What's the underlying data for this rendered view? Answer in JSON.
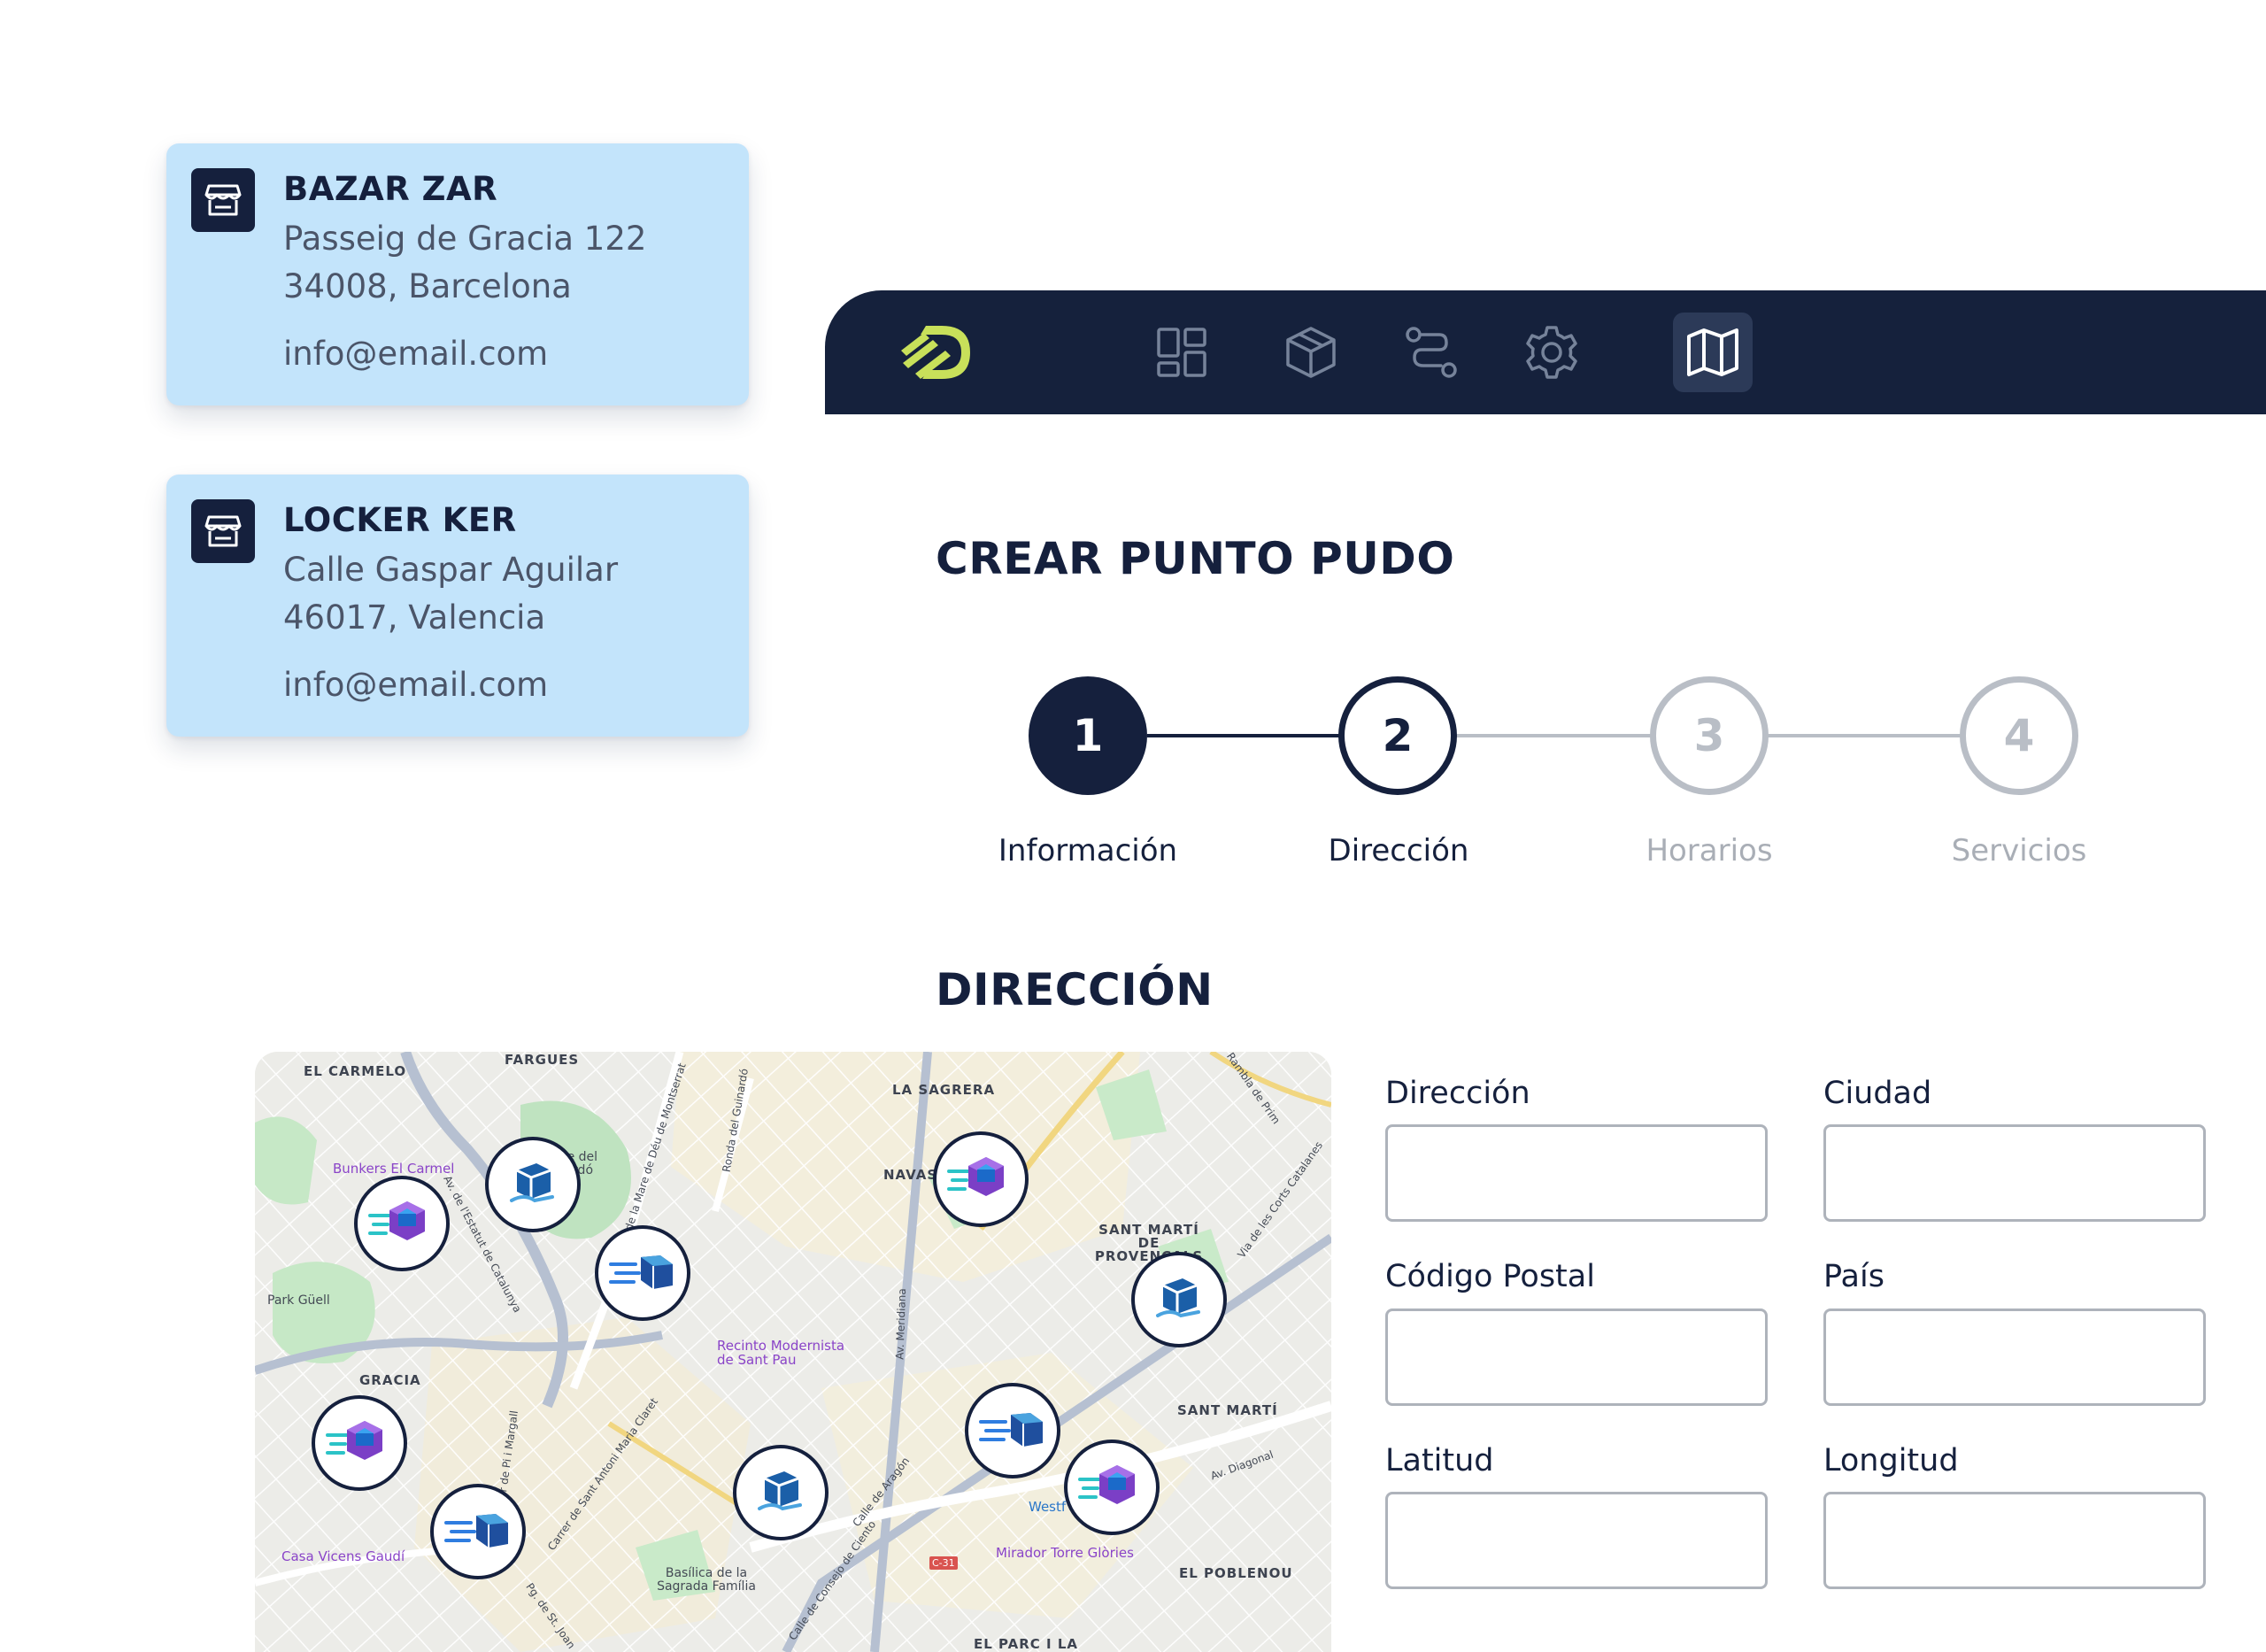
{
  "cards": [
    {
      "name": "BAZAR ZAR",
      "street": "Passeig de Gracia 122",
      "city": "34008, Barcelona",
      "email": "info@email.com"
    },
    {
      "name": "LOCKER KER",
      "street": "Calle Gaspar Aguilar",
      "city": "46017, Valencia",
      "email": "info@email.com"
    }
  ],
  "nav": {
    "logo": "logo-icon",
    "items": [
      "dashboard-icon",
      "package-icon",
      "route-icon",
      "settings-icon",
      "map-icon"
    ],
    "active_item": "map-icon"
  },
  "page": {
    "title": "CREAR PUNTO PUDO",
    "steps": [
      {
        "number": "1",
        "label": "Información",
        "state": "done"
      },
      {
        "number": "2",
        "label": "Dirección",
        "state": "current"
      },
      {
        "number": "3",
        "label": "Horarios",
        "state": "todo"
      },
      {
        "number": "4",
        "label": "Servicios",
        "state": "todo"
      }
    ],
    "section_title": "DIRECCIÓN"
  },
  "map": {
    "areas": {
      "el_carmelo": "EL CARMELO",
      "fargues": "FARGUES",
      "la_sagrera": "LA SAGRERA",
      "navas": "NAVAS",
      "sant_marti_provencals": "SANT MARTÍ DE PROVENÇALS",
      "gracia": "GRACIA",
      "sant_marti": "SANT MARTÍ",
      "el_poblenou": "EL POBLENOU",
      "el_parc": "EL PARC I LA"
    },
    "pois": {
      "bunkers": "Bunkers El Carmel",
      "parque": "Parque del Guinardó",
      "park_guell": "Park Güell",
      "recinto": "Recinto Modernista de Sant Pau",
      "casa_vicens": "Casa Vicens Gaudí",
      "basilica": "Basílica de la Sagrada Família",
      "mirador": "Mirador Torre Glòries",
      "westfield": "Westf"
    },
    "streets": {
      "rambla_prim": "Rambla de Prim",
      "av_montserrat": "Av. de la Mare de Déu de Montserrat",
      "ronda_guinardo": "Ronda del Guinardó",
      "av_estatut": "Av. de l'Estatut de Catalunya",
      "av_meridiana": "Av. Meridiana",
      "via_corts": "Via de les Corts Catalanes",
      "pi_margall": "Carrer de Pi i Margall",
      "antoni_claret": "Carrer de Sant Antoni Maria Claret",
      "calle_aragon": "Calle de Aragón",
      "consejo_ciento": "Calle de Consejo de Ciento",
      "av_diagonal": "Av. Diagonal",
      "pg_sant_joan": "Pg. de St. Joan",
      "c31": "C-31"
    },
    "markers": [
      "hex-parcel",
      "box-hand",
      "fast-parcel",
      "hex-parcel",
      "box-hand",
      "hex-parcel",
      "fast-parcel",
      "box-hand",
      "fast-parcel",
      "hex-parcel"
    ]
  },
  "form": {
    "fields": [
      {
        "label": "Dirección",
        "value": ""
      },
      {
        "label": "Ciudad",
        "value": ""
      },
      {
        "label": "Código Postal",
        "value": ""
      },
      {
        "label": "País",
        "value": ""
      },
      {
        "label": "Latitud",
        "value": ""
      },
      {
        "label": "Longitud",
        "value": ""
      }
    ]
  },
  "colors": {
    "navy": "#15203d",
    "card_bg": "#c3e4fb",
    "logo_accent": "#c8e05a",
    "inactive_step": "#b9bec6"
  }
}
